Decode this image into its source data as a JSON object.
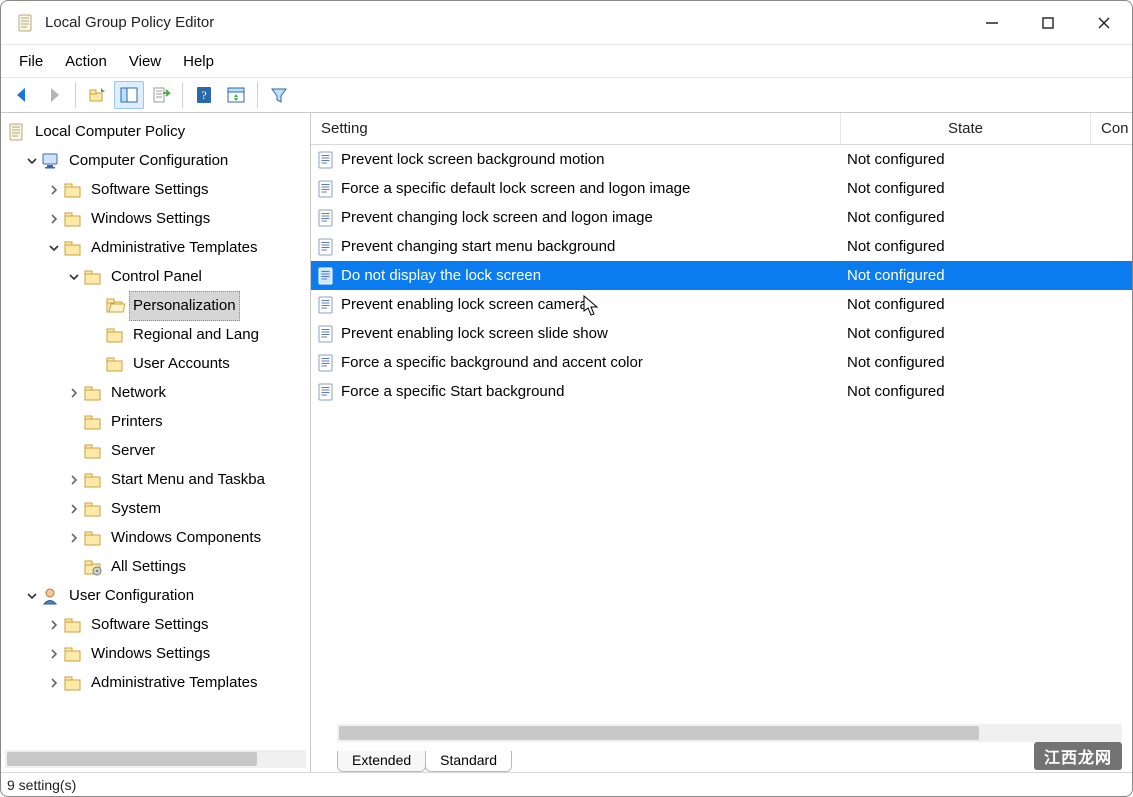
{
  "window": {
    "title": "Local Group Policy Editor"
  },
  "menubar": {
    "items": [
      "File",
      "Action",
      "View",
      "Help"
    ]
  },
  "columns": {
    "setting": "Setting",
    "state": "State",
    "comment": "Con"
  },
  "tabs": {
    "extended": "Extended",
    "standard": "Standard"
  },
  "statusbar": {
    "text": "9 setting(s)"
  },
  "watermark": "江西龙网",
  "tree": [
    {
      "indent": 0,
      "chev": "",
      "icon": "doc",
      "label": "Local Computer Policy",
      "name": "tree-root"
    },
    {
      "indent": 1,
      "chev": "down",
      "icon": "computer",
      "label": "Computer Configuration",
      "name": "tree-computer-config"
    },
    {
      "indent": 2,
      "chev": "right",
      "icon": "folder",
      "label": "Software Settings",
      "name": "tree-cc-software"
    },
    {
      "indent": 2,
      "chev": "right",
      "icon": "folder",
      "label": "Windows Settings",
      "name": "tree-cc-windows"
    },
    {
      "indent": 2,
      "chev": "down",
      "icon": "folder",
      "label": "Administrative Templates",
      "name": "tree-cc-adm"
    },
    {
      "indent": 3,
      "chev": "down",
      "icon": "folder",
      "label": "Control Panel",
      "name": "tree-cc-adm-cp"
    },
    {
      "indent": 4,
      "chev": "",
      "icon": "folder-open",
      "label": "Personalization",
      "name": "tree-personalization",
      "selected": true
    },
    {
      "indent": 4,
      "chev": "",
      "icon": "folder",
      "label": "Regional and Lang",
      "name": "tree-regional"
    },
    {
      "indent": 4,
      "chev": "",
      "icon": "folder",
      "label": "User Accounts",
      "name": "tree-user-accounts"
    },
    {
      "indent": 3,
      "chev": "right",
      "icon": "folder",
      "label": "Network",
      "name": "tree-network"
    },
    {
      "indent": 3,
      "chev": "",
      "icon": "folder",
      "label": "Printers",
      "name": "tree-printers"
    },
    {
      "indent": 3,
      "chev": "",
      "icon": "folder",
      "label": "Server",
      "name": "tree-server"
    },
    {
      "indent": 3,
      "chev": "right",
      "icon": "folder",
      "label": "Start Menu and Taskba",
      "name": "tree-start-menu"
    },
    {
      "indent": 3,
      "chev": "right",
      "icon": "folder",
      "label": "System",
      "name": "tree-system"
    },
    {
      "indent": 3,
      "chev": "right",
      "icon": "folder",
      "label": "Windows Components",
      "name": "tree-win-components"
    },
    {
      "indent": 3,
      "chev": "",
      "icon": "gear-folder",
      "label": "All Settings",
      "name": "tree-all-settings"
    },
    {
      "indent": 1,
      "chev": "down",
      "icon": "user",
      "label": "User Configuration",
      "name": "tree-user-config"
    },
    {
      "indent": 2,
      "chev": "right",
      "icon": "folder",
      "label": "Software Settings",
      "name": "tree-uc-software"
    },
    {
      "indent": 2,
      "chev": "right",
      "icon": "folder",
      "label": "Windows Settings",
      "name": "tree-uc-windows"
    },
    {
      "indent": 2,
      "chev": "right",
      "icon": "folder",
      "label": "Administrative Templates",
      "name": "tree-uc-adm"
    }
  ],
  "settings": [
    {
      "name": "Prevent lock screen background motion",
      "state": "Not configured"
    },
    {
      "name": "Force a specific default lock screen and logon image",
      "state": "Not configured"
    },
    {
      "name": "Prevent changing lock screen and logon image",
      "state": "Not configured"
    },
    {
      "name": "Prevent changing start menu background",
      "state": "Not configured"
    },
    {
      "name": "Do not display the lock screen",
      "state": "Not configured",
      "selected": true
    },
    {
      "name": "Prevent enabling lock screen camera",
      "state": "Not configured"
    },
    {
      "name": "Prevent enabling lock screen slide show",
      "state": "Not configured"
    },
    {
      "name": "Force a specific background and accent color",
      "state": "Not configured"
    },
    {
      "name": "Force a specific Start background",
      "state": "Not configured"
    }
  ]
}
